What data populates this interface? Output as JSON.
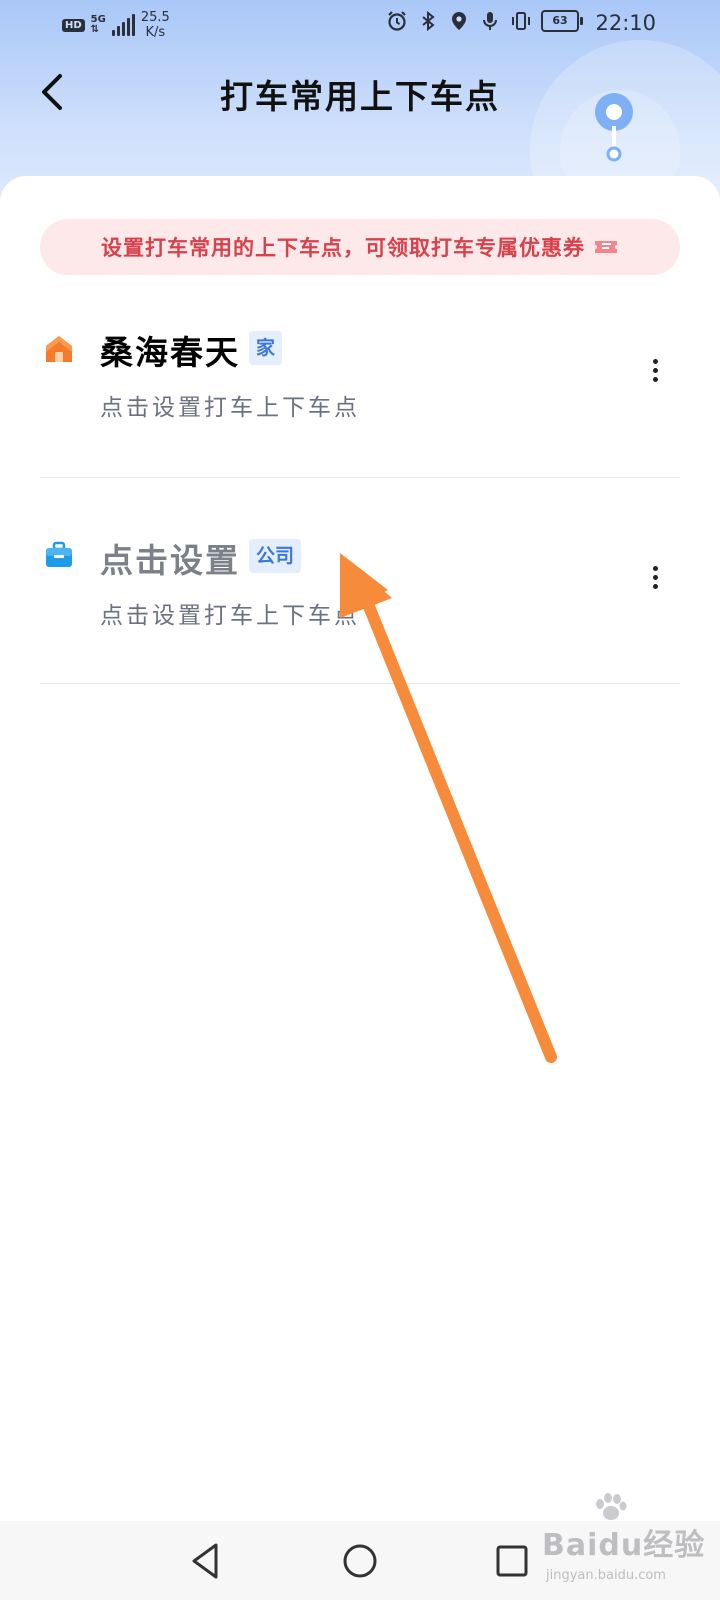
{
  "status_bar": {
    "hd": "HD",
    "network": "5G",
    "speed_value": "25.5",
    "speed_unit": "K/s",
    "battery": "63",
    "time": "22:10",
    "icons": [
      "alarm-icon",
      "bluetooth-icon",
      "location-icon",
      "mic-icon",
      "vibrate-icon",
      "battery-icon"
    ]
  },
  "header": {
    "title": "打车常用上下车点",
    "back_icon": "chevron-left-icon"
  },
  "promo": {
    "text": "设置打车常用的上下车点，可领取打车专属优惠券",
    "icon": "ticket-icon"
  },
  "places": [
    {
      "name": "桑海春天",
      "tag": "家",
      "subtitle": "点击设置打车上下车点",
      "icon": "home-icon",
      "name_color": "#111111"
    },
    {
      "name": "点击设置",
      "tag": "公司",
      "subtitle": "点击设置打车上下车点",
      "icon": "briefcase-icon",
      "name_color": "#7c8089"
    }
  ],
  "nav_bar": {
    "icons": [
      "back-triangle-icon",
      "home-circle-icon",
      "recents-square-icon"
    ]
  },
  "watermark": {
    "main": "Baidu经验",
    "sub": "jingyan.baidu.com"
  },
  "colors": {
    "accent_blue": "#3d78d8",
    "promo_red": "#d6424c",
    "arrow_orange": "#f78b3c",
    "home_orange": "#f57a2a",
    "briefcase_blue": "#1e9be9"
  }
}
